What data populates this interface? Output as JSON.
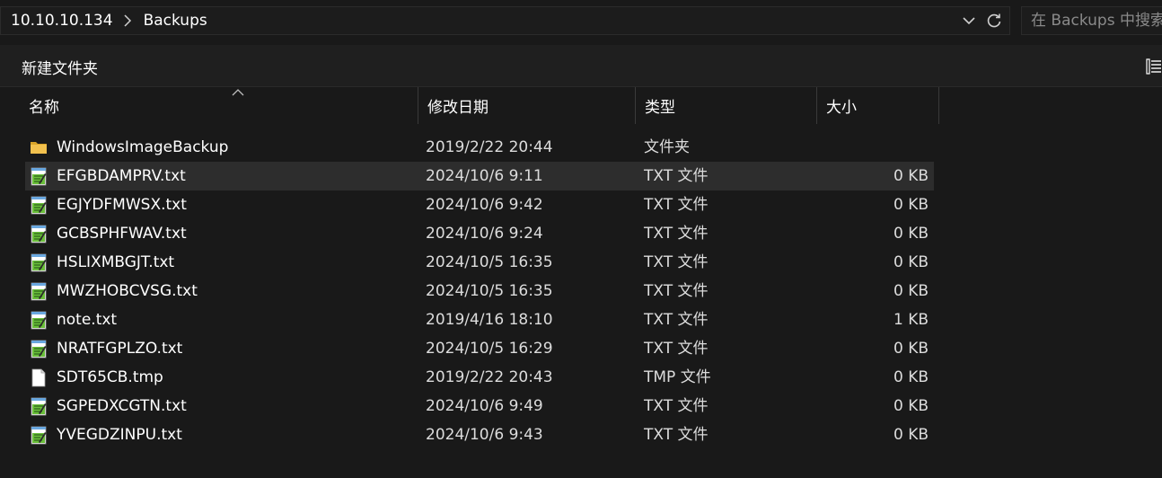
{
  "address": {
    "root": "10.10.10.134",
    "current": "Backups",
    "search_placeholder": "在 Backups 中搜索"
  },
  "toolbar": {
    "new_folder_label": "新建文件夹"
  },
  "columns": {
    "name": "名称",
    "date": "修改日期",
    "type": "类型",
    "size": "大小"
  },
  "files": [
    {
      "name": "WindowsImageBackup",
      "date": "2019/2/22 20:44",
      "type": "文件夹",
      "size": "",
      "icon": "folder-icon"
    },
    {
      "name": "EFGBDAMPRV.txt",
      "date": "2024/10/6 9:11",
      "type": "TXT 文件",
      "size": "0 KB",
      "icon": "txt-file-icon"
    },
    {
      "name": "EGJYDFMWSX.txt",
      "date": "2024/10/6 9:42",
      "type": "TXT 文件",
      "size": "0 KB",
      "icon": "txt-file-icon"
    },
    {
      "name": "GCBSPHFWAV.txt",
      "date": "2024/10/6 9:24",
      "type": "TXT 文件",
      "size": "0 KB",
      "icon": "txt-file-icon"
    },
    {
      "name": "HSLIXMBGJT.txt",
      "date": "2024/10/5 16:35",
      "type": "TXT 文件",
      "size": "0 KB",
      "icon": "txt-file-icon"
    },
    {
      "name": "MWZHOBCVSG.txt",
      "date": "2024/10/5 16:35",
      "type": "TXT 文件",
      "size": "0 KB",
      "icon": "txt-file-icon"
    },
    {
      "name": "note.txt",
      "date": "2019/4/16 18:10",
      "type": "TXT 文件",
      "size": "1 KB",
      "icon": "txt-file-icon"
    },
    {
      "name": "NRATFGPLZO.txt",
      "date": "2024/10/5 16:29",
      "type": "TXT 文件",
      "size": "0 KB",
      "icon": "txt-file-icon"
    },
    {
      "name": "SDT65CB.tmp",
      "date": "2019/2/22 20:43",
      "type": "TMP 文件",
      "size": "0 KB",
      "icon": "blank-file-icon"
    },
    {
      "name": "SGPEDXCGTN.txt",
      "date": "2024/10/6 9:49",
      "type": "TXT 文件",
      "size": "0 KB",
      "icon": "txt-file-icon"
    },
    {
      "name": "YVEGDZINPU.txt",
      "date": "2024/10/6 9:43",
      "type": "TXT 文件",
      "size": "0 KB",
      "icon": "txt-file-icon"
    }
  ],
  "colors": {
    "background": "#191919",
    "command_bar": "#1f1f1f",
    "hover_row": "#2d2d2d",
    "folder_yellow": "#f2c14e",
    "notepad_green": "#6abf3a"
  }
}
